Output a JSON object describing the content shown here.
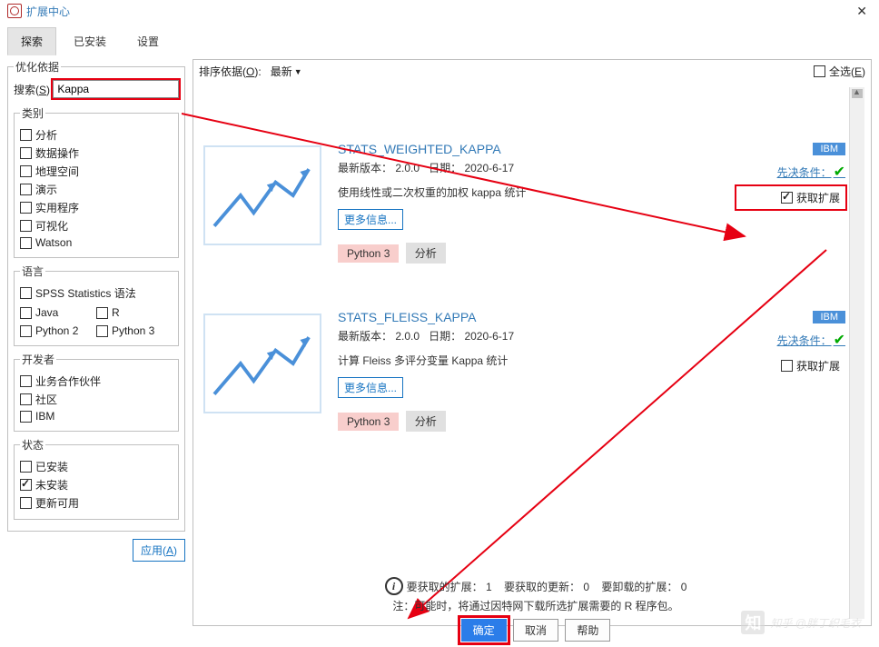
{
  "window": {
    "title": "扩展中心"
  },
  "tabs": {
    "explore": "探索",
    "installed": "已安装",
    "settings": "设置"
  },
  "sidebar": {
    "optimize_legend": "优化依据",
    "search_label": "搜索(S):",
    "search_value": "Kappa",
    "category_legend": "类别",
    "categories": [
      "分析",
      "数据操作",
      "地理空间",
      "演示",
      "实用程序",
      "可视化",
      "Watson"
    ],
    "language_legend": "语言",
    "languages": [
      "SPSS Statistics 语法",
      "Java",
      "R",
      "Python 2",
      "Python 3"
    ],
    "developer_legend": "开发者",
    "developers": [
      "业务合作伙伴",
      "社区",
      "IBM"
    ],
    "status_legend": "状态",
    "statuses": [
      {
        "label": "已安装",
        "checked": false
      },
      {
        "label": "未安装",
        "checked": true
      },
      {
        "label": "更新可用",
        "checked": false
      }
    ],
    "apply": "应用(A)"
  },
  "main": {
    "sort_label": "排序依据(O):",
    "sort_value": "最新",
    "select_all": "全选(E)",
    "cards": [
      {
        "title": "STATS_WEIGHTED_KAPPA",
        "version_label": "最新版本：",
        "version": "2.0.0",
        "date_label": "日期：",
        "date": "2020-6-17",
        "desc": "使用线性或二次权重的加权 kappa 统计",
        "more": "更多信息...",
        "tag_py": "Python 3",
        "tag_an": "分析",
        "ibm": "IBM",
        "prereq": "先决条件：",
        "acquire": "获取扩展",
        "acquire_checked": true,
        "highlight": true
      },
      {
        "title": "STATS_FLEISS_KAPPA",
        "version_label": "最新版本：",
        "version": "2.0.0",
        "date_label": "日期：",
        "date": "2020-6-17",
        "desc": "计算 Fleiss 多评分变量 Kappa 统计",
        "more": "更多信息...",
        "tag_py": "Python 3",
        "tag_an": "分析",
        "ibm": "IBM",
        "prereq": "先决条件：",
        "acquire": "获取扩展",
        "acquire_checked": false,
        "highlight": false
      }
    ]
  },
  "footer": {
    "summary_a": "要获取的扩展：",
    "summary_a_v": "1",
    "summary_b": "要获取的更新：",
    "summary_b_v": "0",
    "summary_c": "要卸载的扩展：",
    "summary_c_v": "0",
    "note": "注：可能时，将通过因特网下载所选扩展需要的 R 程序包。",
    "ok": "确定",
    "cancel": "取消",
    "help": "帮助"
  },
  "watermark": "知乎 @胖丁织毛衣"
}
